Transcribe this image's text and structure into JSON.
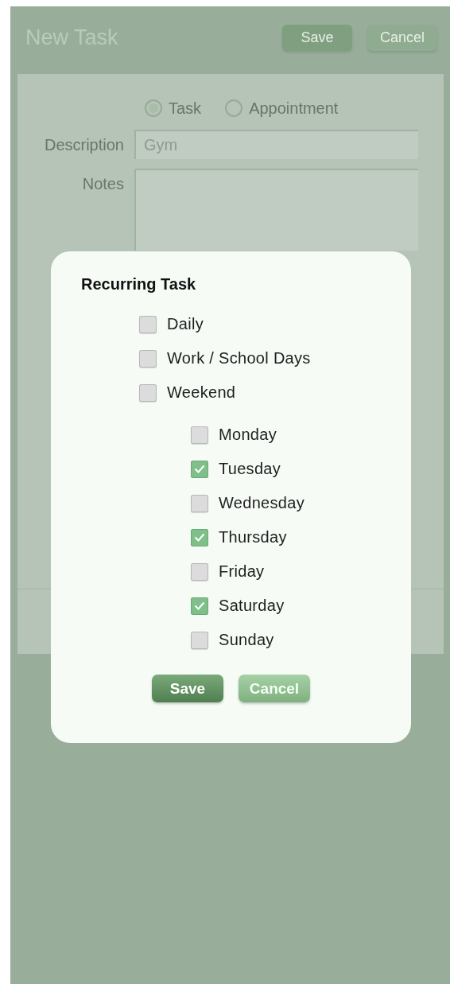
{
  "header": {
    "title": "New Task",
    "buttons": [
      {
        "label": "Save",
        "kind": "primary"
      },
      {
        "label": "Cancel",
        "kind": "secondary"
      }
    ]
  },
  "form": {
    "type_options": [
      {
        "label": "Task",
        "selected": true
      },
      {
        "label": "Appointment",
        "selected": false
      }
    ],
    "description": {
      "label": "Description",
      "value": "Gym"
    },
    "notes": {
      "label": "Notes"
    }
  },
  "dialog": {
    "title": "Recurring Task",
    "presets": [
      {
        "label": "Daily",
        "checked": false
      },
      {
        "label": "Work / School Days",
        "checked": false
      },
      {
        "label": "Weekend",
        "checked": false
      }
    ],
    "days": [
      {
        "label": "Monday",
        "checked": false
      },
      {
        "label": "Tuesday",
        "checked": true
      },
      {
        "label": "Wednesday",
        "checked": false
      },
      {
        "label": "Thursday",
        "checked": true
      },
      {
        "label": "Friday",
        "checked": false
      },
      {
        "label": "Saturday",
        "checked": true
      },
      {
        "label": "Sunday",
        "checked": false
      }
    ],
    "buttons": [
      {
        "label": "Save",
        "kind": "primary"
      },
      {
        "label": "Cancel",
        "kind": "secondary"
      }
    ]
  }
}
